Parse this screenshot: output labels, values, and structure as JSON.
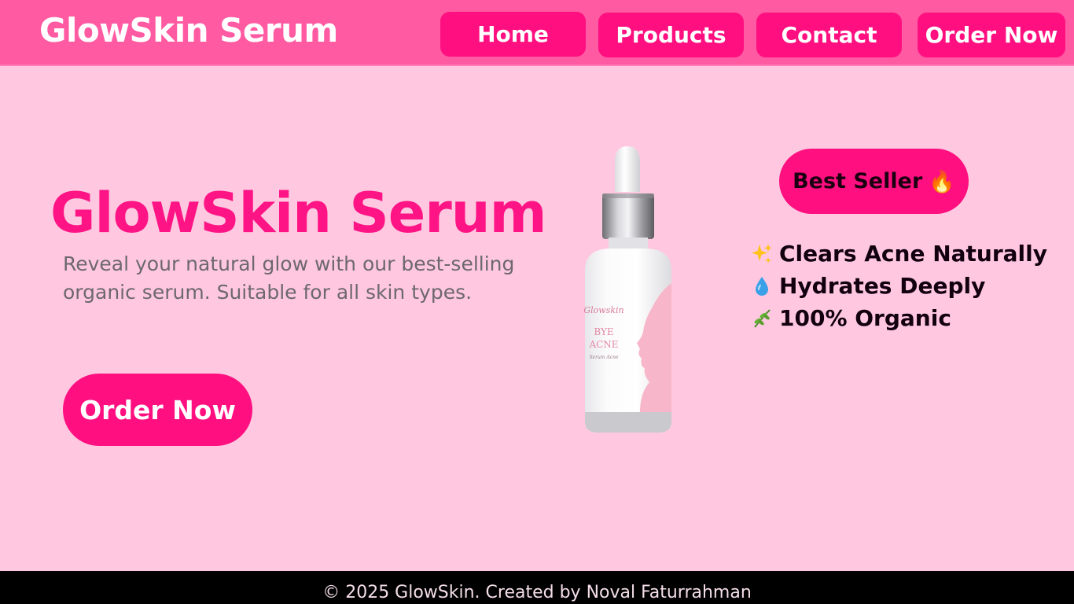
{
  "header": {
    "brand": "GlowSkin Serum",
    "nav": {
      "home": "Home",
      "products": "Products",
      "contact": "Contact",
      "order": "Order Now"
    }
  },
  "hero": {
    "title": "GlowSkin Serum",
    "description": "Reveal your natural glow with our best-selling organic serum. Suitable for all skin types.",
    "order_button": "Order Now"
  },
  "product_label": {
    "brand": "Glowskin",
    "line1": "BYE",
    "line2": "ACNE",
    "sub": "Serum Acne"
  },
  "badge": {
    "label": "Best Seller",
    "emoji": "🔥"
  },
  "features": [
    {
      "icon": "sparkles-icon",
      "label": "Clears Acne Naturally"
    },
    {
      "icon": "droplet-icon",
      "label": "Hydrates Deeply"
    },
    {
      "icon": "herb-icon",
      "label": "100% Organic"
    }
  ],
  "footer": {
    "text": "© 2025 GlowSkin. Created by Noval Faturrahman"
  },
  "colors": {
    "accent": "#ff0f80",
    "header_bg": "#ff5aa2",
    "page_bg": "#ffc8e0",
    "footer_bg": "#000000"
  }
}
